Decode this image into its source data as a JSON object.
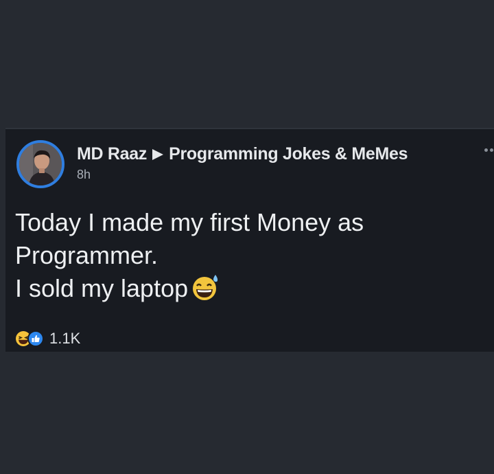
{
  "post": {
    "author": "MD Raaz",
    "group": "Programming Jokes & MeMes",
    "time": "8h",
    "text_lines": [
      "Today I made my first Money as",
      "Programmer.",
      "I sold my laptop"
    ],
    "emoji": "grinning-sweat-emoji",
    "reactions": {
      "icons": [
        "haha-reaction-icon",
        "like-reaction-icon"
      ],
      "count": "1.1K"
    }
  },
  "colors": {
    "background": "#262a31",
    "card": "#181b21",
    "accent": "#2f7ee0",
    "text": "#eef0f2",
    "muted": "#a9afb8"
  }
}
